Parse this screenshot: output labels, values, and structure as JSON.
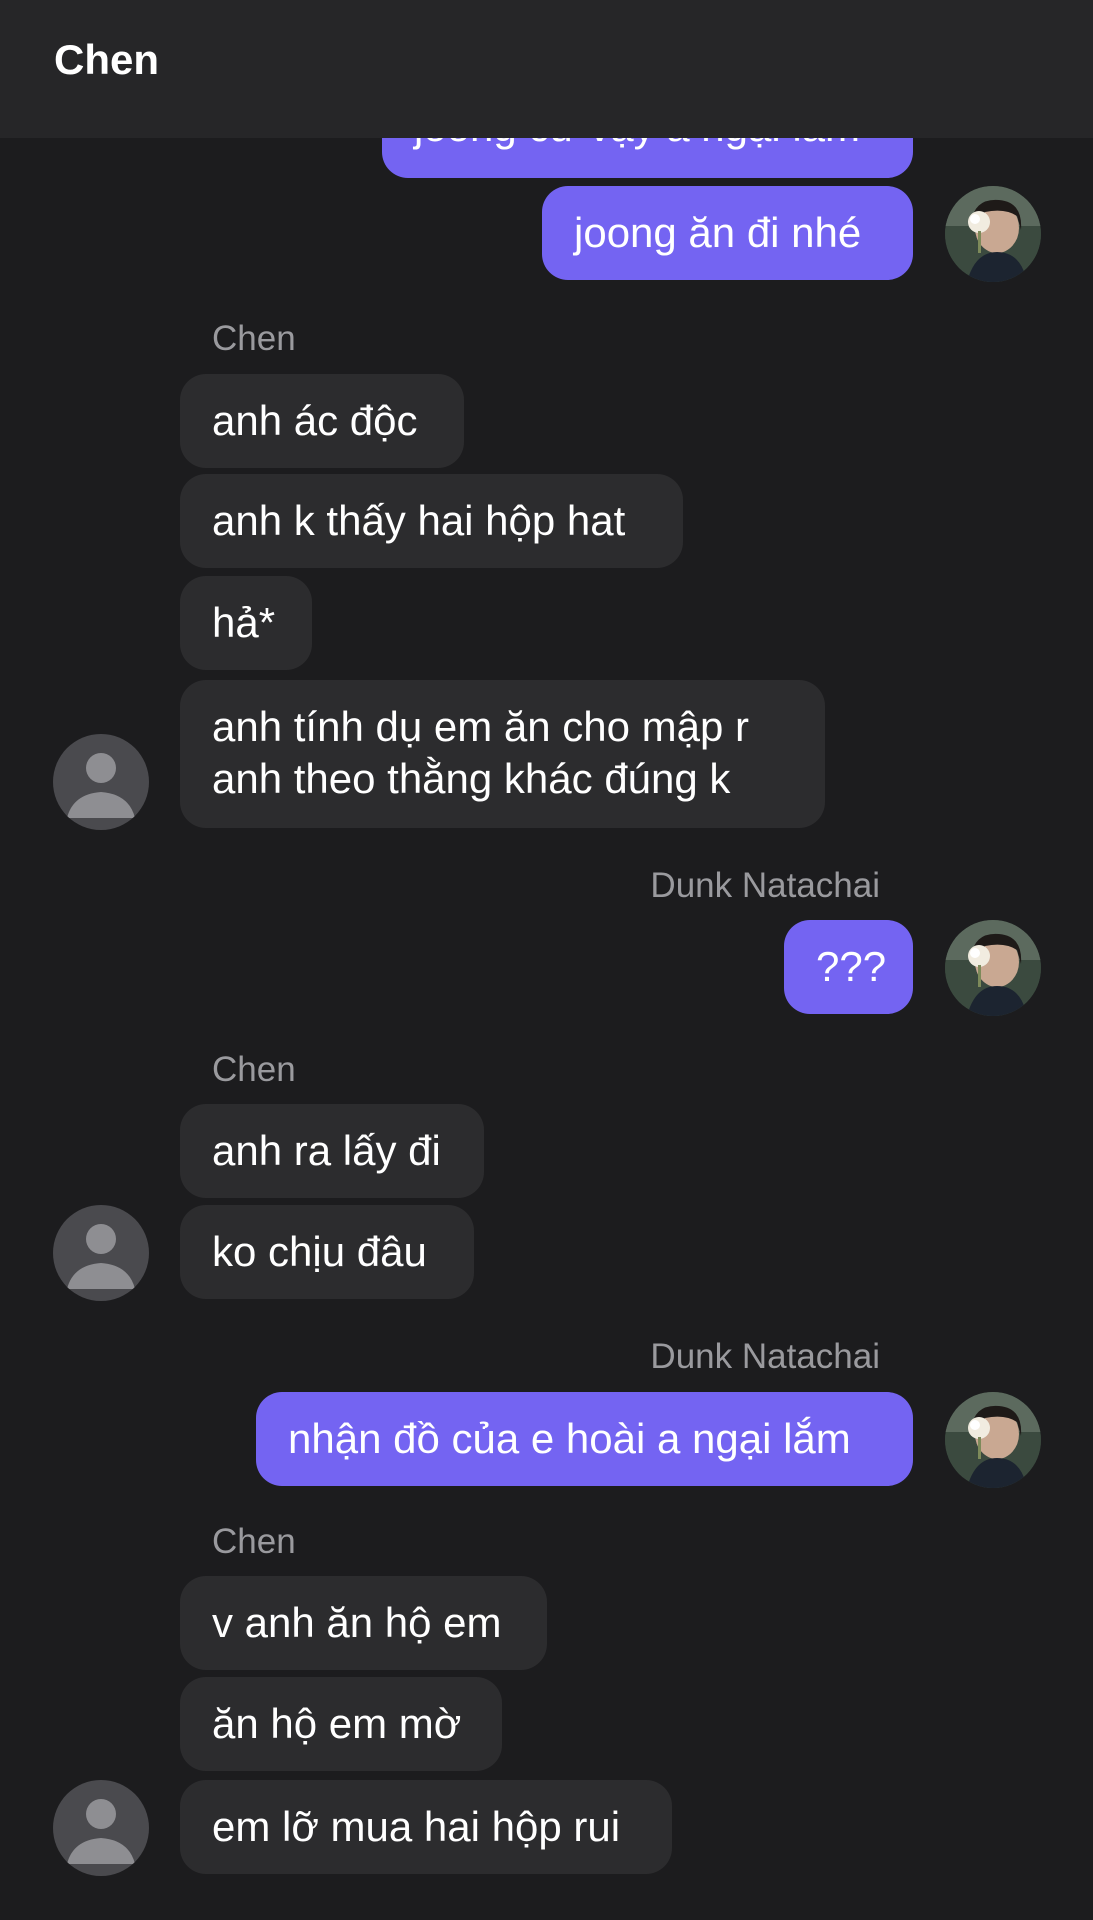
{
  "header": {
    "title": "Chen"
  },
  "messages": {
    "m0": "joong cứ vậy a ngại lắm",
    "m1": "joong ăn đi nhé",
    "name_chen_1": "Chen",
    "m2": "anh ác độc",
    "m3": "anh k thấy hai hộp hat",
    "m4": "hả*",
    "m5_line1": "anh tính dụ em ăn cho mập r",
    "m5_line2": "anh theo thằng khác đúng k",
    "name_dunk_1": "Dunk Natachai",
    "m6": "???",
    "name_chen_2": "Chen",
    "m7": "anh ra lấy đi",
    "m8": "ko chịu đâu",
    "name_dunk_2": "Dunk Natachai",
    "m9": "nhận đồ của e hoài a ngại lắm",
    "name_chen_3": "Chen",
    "m10": "v anh ăn hộ em",
    "m11": "ăn hộ em mờ",
    "m12": "em lỡ mua hai hộp rui"
  },
  "colors": {
    "outgoing_bubble": "#7464f2",
    "incoming_bubble": "#2c2c2e",
    "background": "#1c1c1e",
    "header": "#262628"
  },
  "icons": {
    "default_avatar": "person-silhouette-icon",
    "user_avatar": "profile-photo"
  }
}
